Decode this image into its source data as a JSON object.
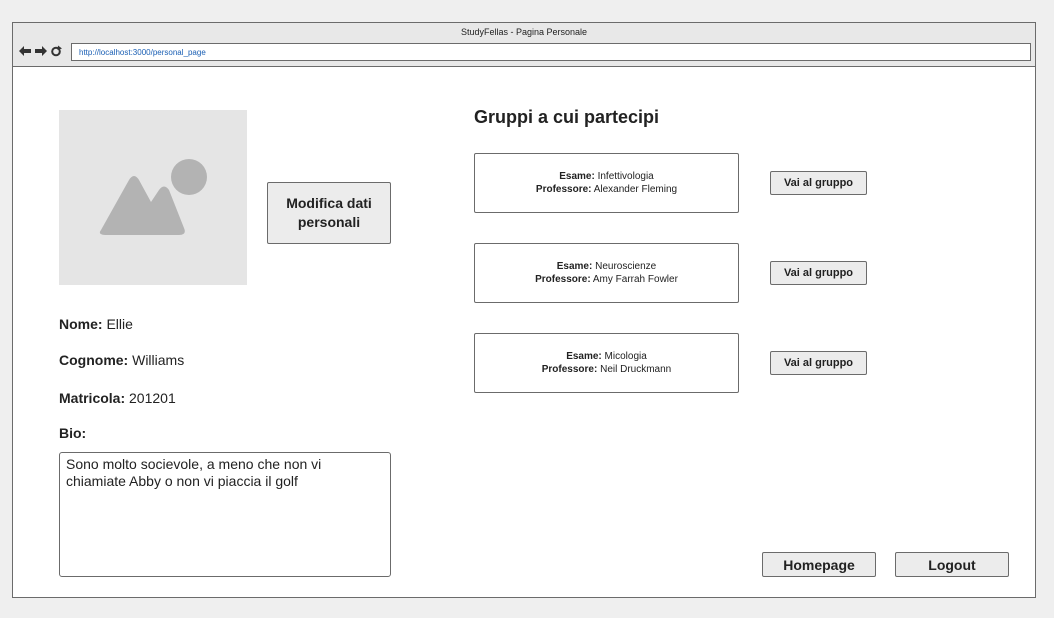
{
  "window": {
    "title": "StudyFellas - Pagina Personale",
    "url": "http://localhost:3000/personal_page"
  },
  "profile": {
    "edit_button_label": "Modifica dati personali",
    "fields": {
      "nome_label": "Nome:",
      "nome_value": "Ellie",
      "cognome_label": "Cognome:",
      "cognome_value": "Williams",
      "matricola_label": "Matricola:",
      "matricola_value": "201201",
      "bio_label": "Bio:",
      "bio_value": "Sono molto socievole, a meno che non vi chiamiate Abby o non vi piaccia il golf"
    }
  },
  "groups": {
    "title": "Gruppi a cui partecipi",
    "exam_label": "Esame:",
    "professor_label": "Professore:",
    "button_label": "Vai al gruppo",
    "items": [
      {
        "exam": "Infettivologia",
        "professor": "Alexander Fleming"
      },
      {
        "exam": "Neuroscienze",
        "professor": "Amy Farrah Fowler"
      },
      {
        "exam": "Micologia",
        "professor": "Neil Druckmann"
      }
    ]
  },
  "footer": {
    "homepage_label": "Homepage",
    "logout_label": "Logout"
  },
  "icons": {
    "back": "arrow-left-icon",
    "forward": "arrow-right-icon",
    "reload": "reload-icon",
    "photo": "image-placeholder-icon"
  }
}
